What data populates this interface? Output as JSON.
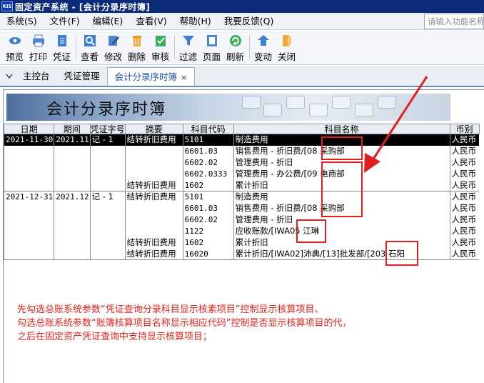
{
  "window": {
    "logo": "KIS",
    "title": "固定资产系统 - [会计分录序时簿]"
  },
  "menu": [
    "系统(S)",
    "文件(F)",
    "编辑(E)",
    "查看(V)",
    "帮助(H)",
    "我要反馈(Q)"
  ],
  "search": {
    "placeholder": "请输入功能名称"
  },
  "toolbar": [
    {
      "label": "预览",
      "icon": "preview-icon"
    },
    {
      "label": "打印",
      "icon": "print-icon"
    },
    {
      "label": "凭证",
      "icon": "voucher-icon"
    },
    {
      "label": "查看",
      "icon": "view-icon"
    },
    {
      "label": "修改",
      "icon": "edit-icon"
    },
    {
      "label": "删除",
      "icon": "delete-icon"
    },
    {
      "label": "审核",
      "icon": "audit-icon"
    },
    {
      "label": "过滤",
      "icon": "filter-icon"
    },
    {
      "label": "页面",
      "icon": "page-icon"
    },
    {
      "label": "刷新",
      "icon": "refresh-icon"
    },
    {
      "label": "变动",
      "icon": "change-icon"
    },
    {
      "label": "关闭",
      "icon": "close-icon"
    }
  ],
  "tabs": [
    {
      "label": "主控台",
      "active": false
    },
    {
      "label": "凭证管理",
      "active": false
    },
    {
      "label": "会计分录序时簿",
      "active": true,
      "close": "×"
    }
  ],
  "report": {
    "title": "会计分录序时簿",
    "columns": [
      "日期",
      "期间",
      "凭证字号",
      "摘要",
      "科目代码",
      "科目名称",
      "币别"
    ],
    "rows": [
      [
        "2021-11-30",
        "2021.11",
        "记 - 1",
        "结转折旧费用",
        "5101",
        "制造费用",
        "人民币"
      ],
      [
        "",
        "",
        "",
        "",
        "6601.03",
        "销售费用 - 折旧费/[08 采购部",
        "人民币"
      ],
      [
        "",
        "",
        "",
        "",
        "6602.02",
        "管理费用 - 折旧",
        "人民币"
      ],
      [
        "",
        "",
        "",
        "",
        "6602.0333",
        "管理费用 - 办公费/[09 电商部",
        "人民币"
      ],
      [
        "",
        "",
        "",
        "结转折旧费用",
        "1602",
        "累计折旧",
        "人民币"
      ],
      [
        "2021-12-31",
        "2021.12",
        "记 - 1",
        "结转折旧费用",
        "5101",
        "制造费用",
        "人民币"
      ],
      [
        "",
        "",
        "",
        "",
        "6601.03",
        "销售费用 - 折旧费/[08 采购部",
        "人民币"
      ],
      [
        "",
        "",
        "",
        "",
        "6602.02",
        "管理费用 - 折旧",
        "人民币"
      ],
      [
        "",
        "",
        "",
        "",
        "1122",
        "应收账款/[IWA05 江琳",
        "人民币"
      ],
      [
        "",
        "",
        "",
        "结转折旧费用",
        "1602",
        "累计折旧",
        "人民币"
      ],
      [
        "",
        "",
        "",
        "结转折旧费用",
        "16020",
        "累计折旧/[IWA02]沛典/[13]批发部/[203 石阳",
        "人民币"
      ]
    ]
  },
  "note": [
    "先勾选总账系统参数“凭证查询分录科目显示核素项目”控制显示核算项目、",
    "勾选总账系统参数“账簿核算项目名称显示相应代码”控制是否显示核算项目的代，",
    "之后在固定资产凭证查询中支持显示核算项目；"
  ],
  "colors": {
    "title_bar": "#0b2a7a",
    "highlight": "#e02020",
    "note_text": "#e8231c"
  }
}
